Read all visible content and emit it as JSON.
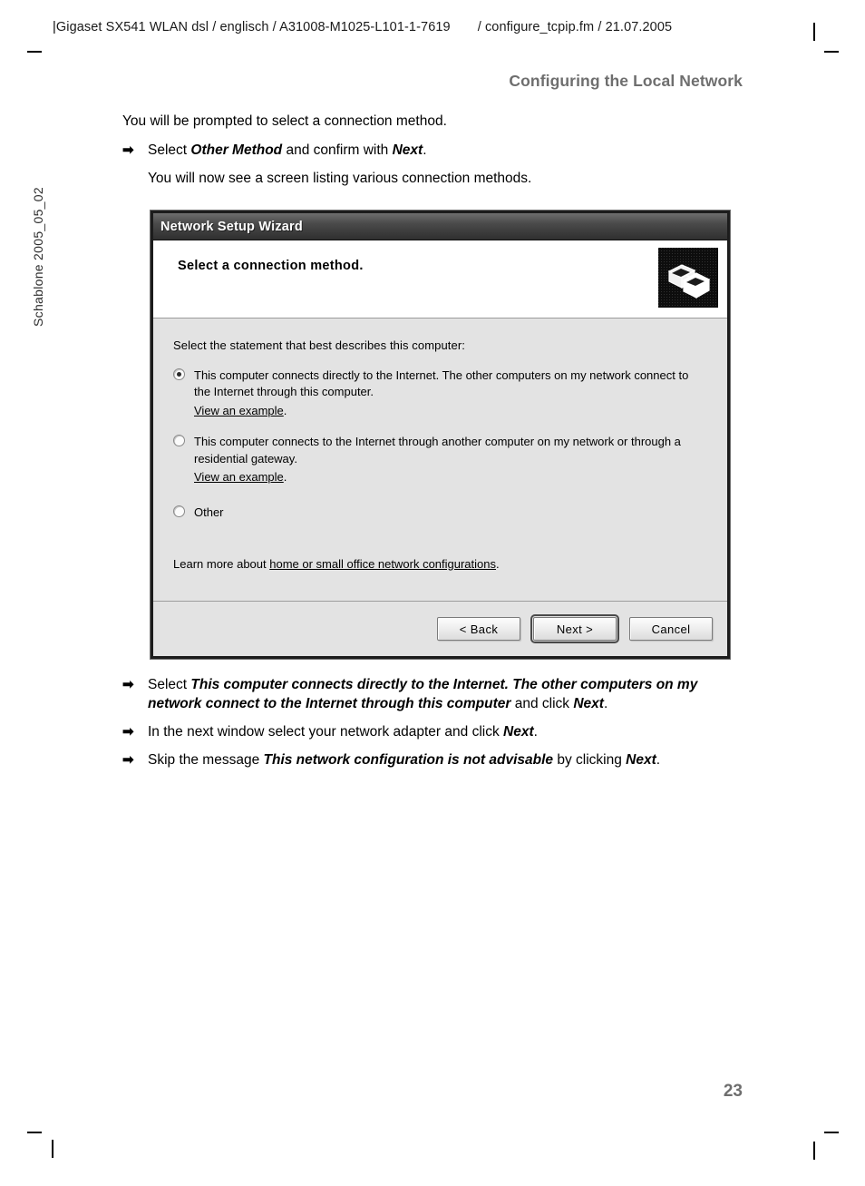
{
  "print_header": {
    "left_bar": "|",
    "doc_ref": "Gigaset SX541 WLAN dsl / englisch / A31008-M1025-L101-1-7619",
    "file_ref": "/ configure_tcpip.fm / 21.07.2005"
  },
  "side_marker": "Schablone 2005_05_02",
  "section_title": "Configuring the Local Network",
  "page_number": "23",
  "intro": {
    "line1": "You will be prompted to select a connection method."
  },
  "steps_before": [
    {
      "arrow": "➡",
      "prefix": "Select ",
      "bold1": "Other Method",
      "middle": " and confirm with ",
      "bold2": "Next",
      "suffix": ".",
      "note": "You will now see a screen listing various connection methods."
    }
  ],
  "dialog": {
    "title": "Network Setup Wizard",
    "header_title": "Select a connection method.",
    "icon_name": "two-networked-computers-icon",
    "prompt": "Select the statement that best describes this computer:",
    "options": [
      {
        "id": "direct",
        "selected": true,
        "text": "This computer connects directly to the Internet. The other computers on my network connect to the Internet through this computer.",
        "link": "View an example",
        "link_suffix": "."
      },
      {
        "id": "through-another",
        "selected": false,
        "text": "This computer connects to the Internet through another computer on my network or through a residential gateway.",
        "link": "View an example",
        "link_suffix": "."
      },
      {
        "id": "other",
        "selected": false,
        "text": "Other",
        "link": "",
        "link_suffix": ""
      }
    ],
    "learn_more": {
      "prefix": "Learn more about ",
      "link": "home or small office network configurations",
      "suffix": "."
    },
    "buttons": {
      "back": "< Back",
      "next": "Next >",
      "cancel": "Cancel"
    }
  },
  "steps_after": [
    {
      "arrow": "➡",
      "prefix": "Select ",
      "bold1": "This computer connects directly to the Internet. The other computers on my network connect to the Internet through this computer",
      "middle": " and click ",
      "bold2": "Next",
      "suffix": "."
    },
    {
      "arrow": "➡",
      "prefix": "In the next window select your network adapter and click ",
      "bold1": "Next",
      "middle": "",
      "bold2": "",
      "suffix": "."
    },
    {
      "arrow": "➡",
      "prefix": "Skip the message ",
      "bold1": "This network configuration is not advisable",
      "middle": " by clicking ",
      "bold2": "Next",
      "suffix": "."
    }
  ]
}
